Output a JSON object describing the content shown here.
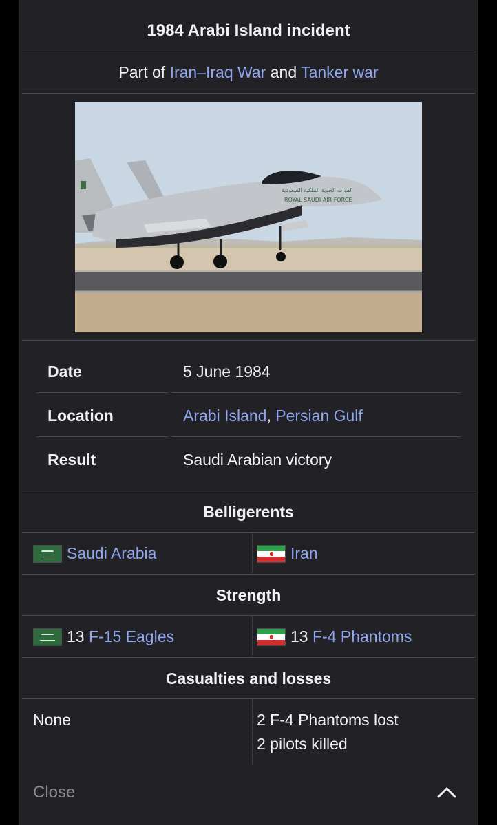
{
  "infobox": {
    "title": "1984 Arabi Island incident",
    "part_of": {
      "prefix": "Part of",
      "link1": "Iran–Iraq War",
      "conjunction": "and",
      "link2": "Tanker war"
    },
    "image": {
      "aircraft_lettering_ar": "القوات الجوية الملكية السعودية",
      "aircraft_lettering_en": "ROYAL SAUDI AIR FORCE"
    },
    "rows": [
      {
        "label": "Date",
        "value": "5 June 1984"
      },
      {
        "label": "Location",
        "link1": "Arabi Island",
        "separator": ",",
        "link2": "Persian Gulf"
      },
      {
        "label": "Result",
        "value": "Saudi Arabian victory"
      }
    ],
    "belligerents": {
      "heading": "Belligerents",
      "left": {
        "flag": "flag-saudi-arabia",
        "name": "Saudi Arabia"
      },
      "right": {
        "flag": "flag-iran",
        "name": "Iran"
      }
    },
    "strength": {
      "heading": "Strength",
      "left": {
        "flag": "flag-saudi-arabia",
        "count": "13",
        "unit": "F-15 Eagles"
      },
      "right": {
        "flag": "flag-iran",
        "count": "13",
        "unit": "F-4 Phantoms"
      }
    },
    "casualties": {
      "heading": "Casualties and losses",
      "left": "None",
      "right_line1": "2 F-4 Phantoms lost",
      "right_line2": "2 pilots killed"
    }
  },
  "footer": {
    "close_label": "Close",
    "collapse_icon": "chevron-up-icon"
  },
  "colors": {
    "background": "#222226",
    "text": "#f1f1f3",
    "link": "#8fa6ee",
    "separator": "#4a4a50"
  }
}
